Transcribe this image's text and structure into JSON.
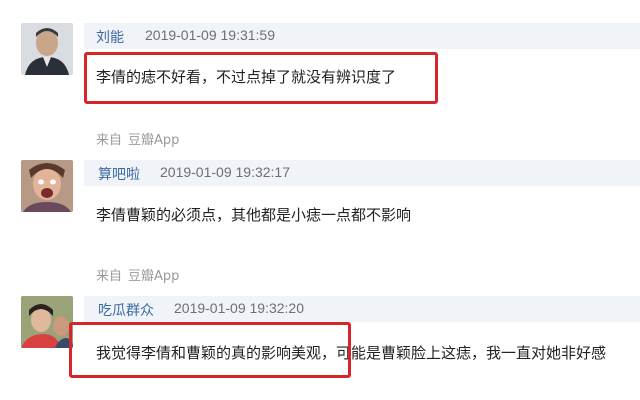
{
  "comments": [
    {
      "username": "刘能",
      "timestamp": "2019-01-09 19:31:59",
      "text": "李倩的痣不好看，不过点掉了就没有辨识度了",
      "source_prefix": "来自",
      "source_app": "豆瓣App"
    },
    {
      "username": "算吧啦",
      "timestamp": "2019-01-09 19:32:17",
      "text": "李倩曹颖的必须点，其他都是小痣一点都不影响",
      "source_prefix": "来自",
      "source_app": "豆瓣App"
    },
    {
      "username": "吃瓜群众",
      "timestamp": "2019-01-09 19:32:20",
      "text": "我觉得李倩和曹颖的真的影响美观，可能是曹颖脸上这痣，我一直对她非好感"
    }
  ],
  "colors": {
    "highlight": "#d8252a",
    "username": "#3b6aa3",
    "header_bg": "#f0f3f7"
  }
}
